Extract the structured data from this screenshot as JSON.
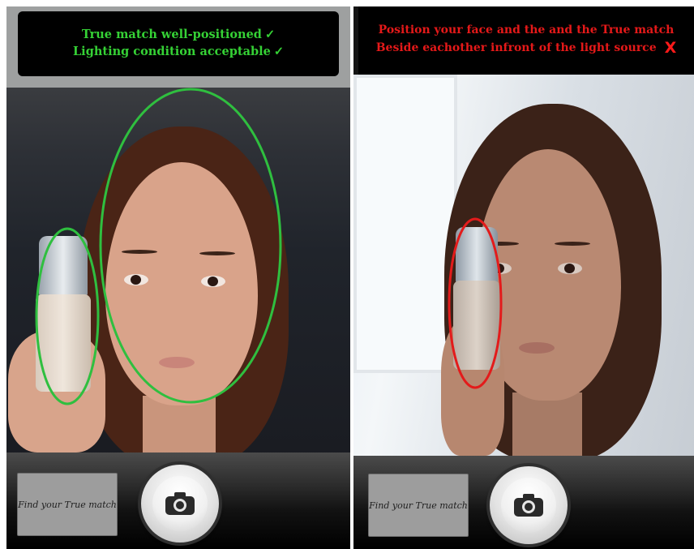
{
  "screens": [
    {
      "status": "valid",
      "banner_lines": [
        "True match well-positioned",
        "Lighting condition acceptable"
      ],
      "status_mark": "✓",
      "ring_color": "#2fbf3f",
      "find_button_label": "Find your True match",
      "shutter_icon": "camera-icon"
    },
    {
      "status": "invalid",
      "banner_lines": [
        "Position your face and the and the True match",
        "Beside eachother infront of the light source"
      ],
      "status_mark": "X",
      "ring_color": "#e31b1b",
      "find_button_label": "Find your True match",
      "shutter_icon": "camera-icon"
    }
  ]
}
